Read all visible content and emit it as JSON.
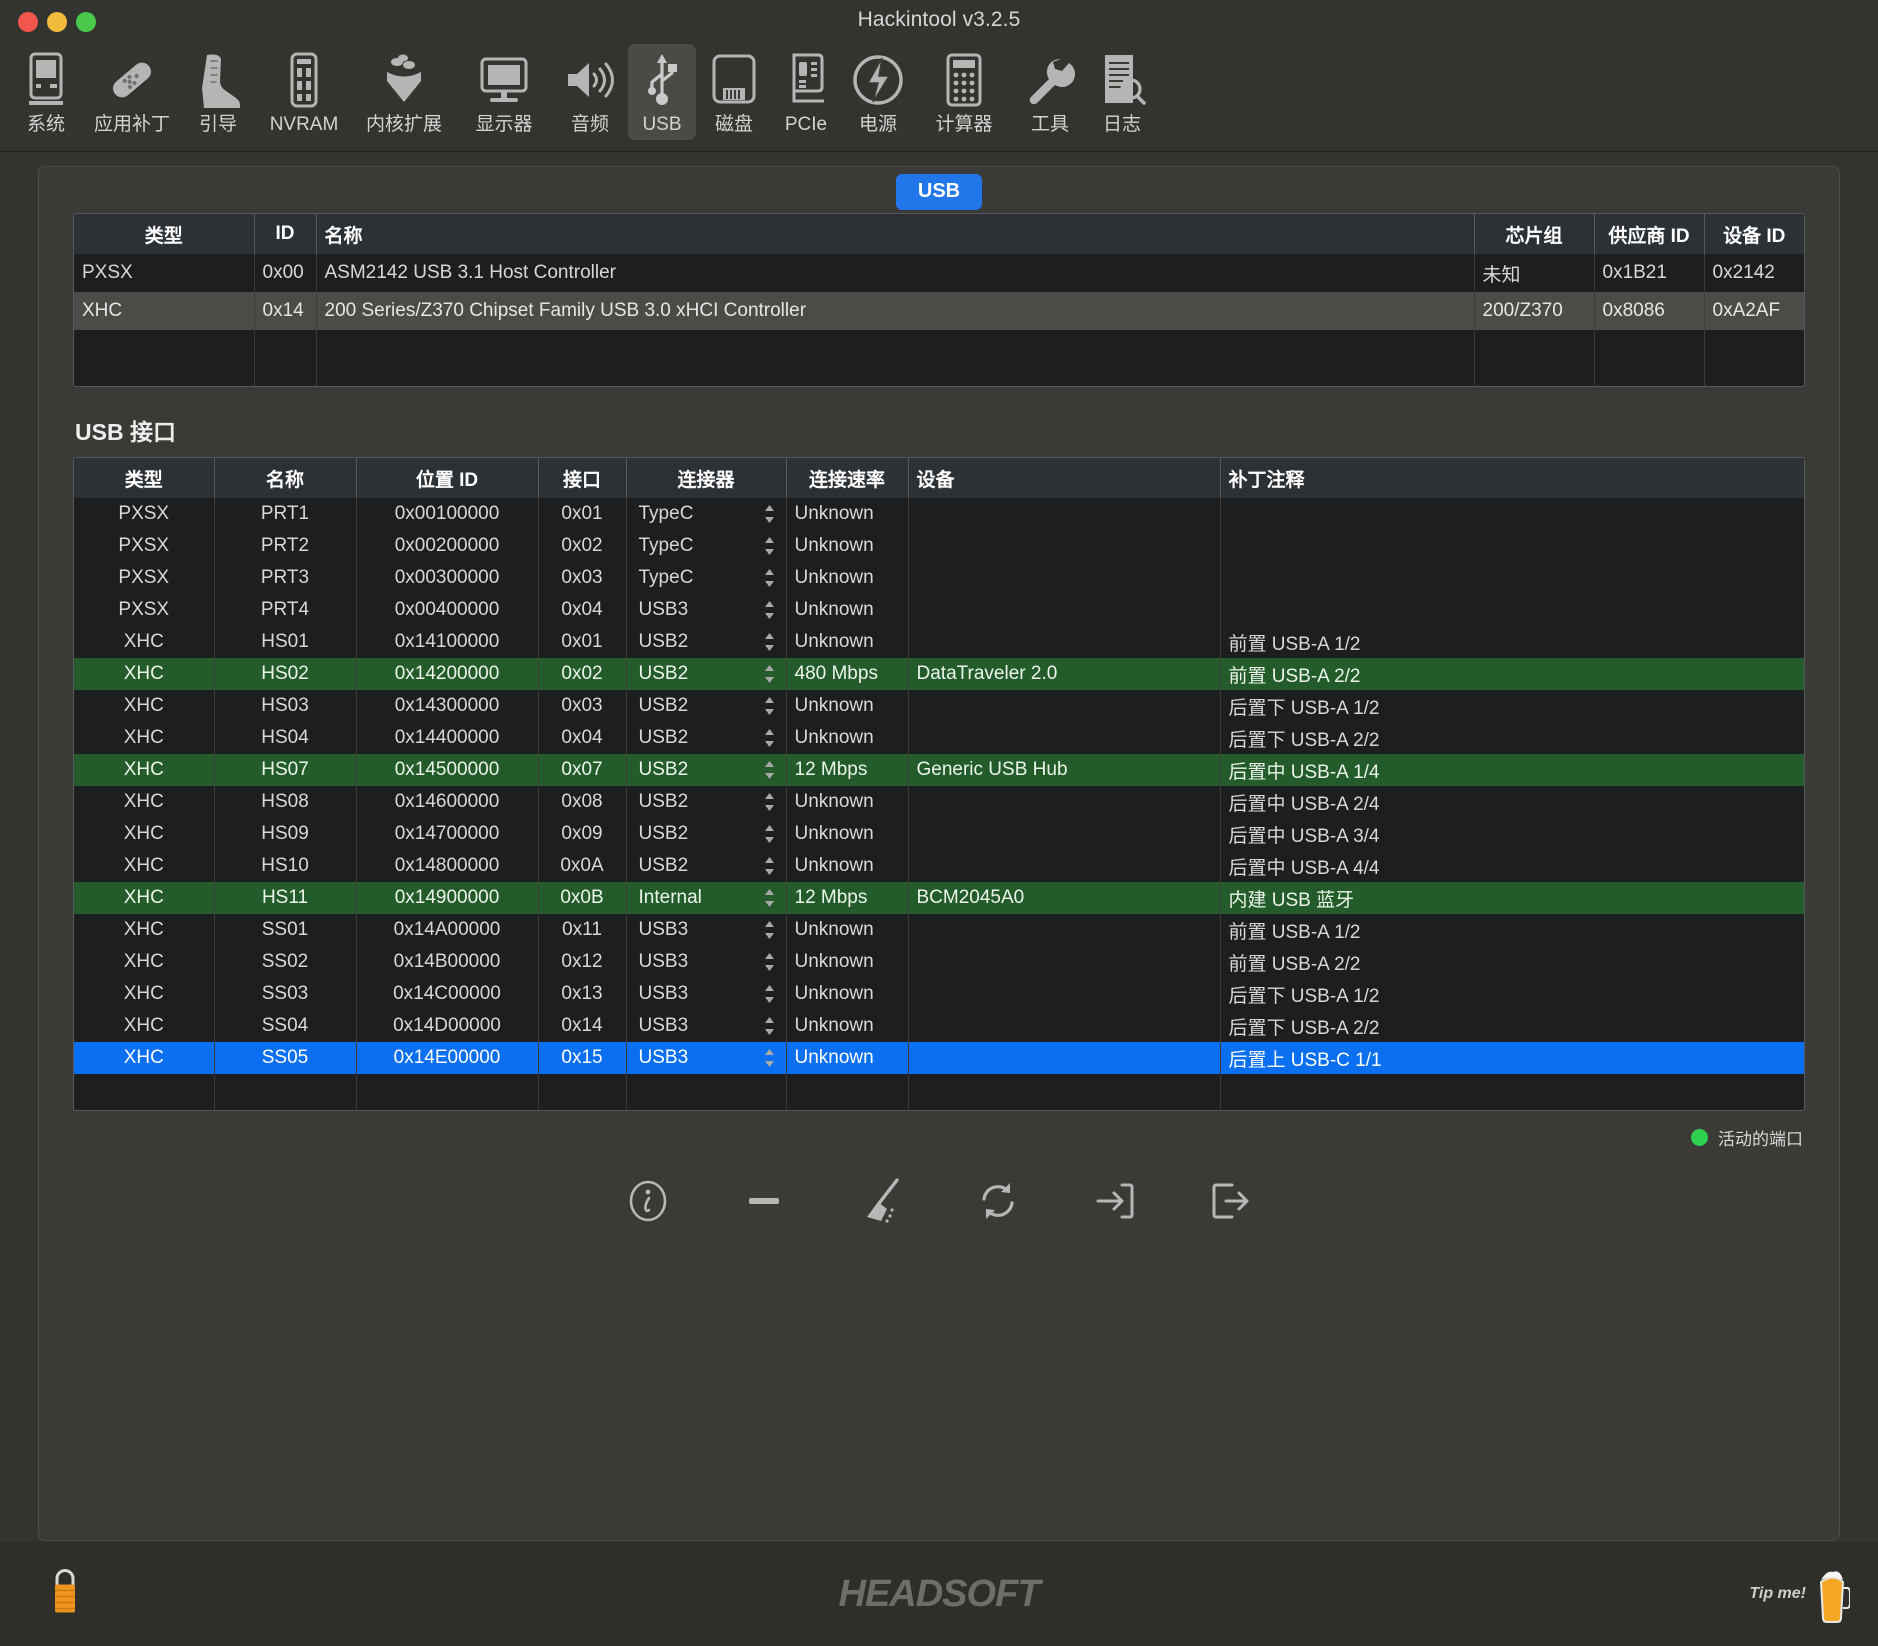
{
  "window": {
    "title": "Hackintool v3.2.5",
    "traffic_lights": [
      "close-button",
      "minimize-button",
      "zoom-button"
    ]
  },
  "toolbar": {
    "items": [
      {
        "label": "系统",
        "icon": "system-icon",
        "selected": false
      },
      {
        "label": "应用补丁",
        "icon": "patch-icon",
        "selected": false
      },
      {
        "label": "引导",
        "icon": "boot-icon",
        "selected": false
      },
      {
        "label": "NVRAM",
        "icon": "nvram-icon",
        "selected": false
      },
      {
        "label": "内核扩展",
        "icon": "kext-icon",
        "selected": false
      },
      {
        "label": "显示器",
        "icon": "display-icon",
        "selected": false
      },
      {
        "label": "音频",
        "icon": "audio-icon",
        "selected": false
      },
      {
        "label": "USB",
        "icon": "usb-icon",
        "selected": true
      },
      {
        "label": "磁盘",
        "icon": "disk-icon",
        "selected": false
      },
      {
        "label": "PCIe",
        "icon": "pcie-icon",
        "selected": false
      },
      {
        "label": "电源",
        "icon": "power-icon",
        "selected": false
      },
      {
        "label": "计算器",
        "icon": "calculator-icon",
        "selected": false
      },
      {
        "label": "工具",
        "icon": "tools-icon",
        "selected": false
      },
      {
        "label": "日志",
        "icon": "log-icon",
        "selected": false
      }
    ]
  },
  "tab": {
    "label": "USB"
  },
  "controllers": {
    "headers": [
      "类型",
      "ID",
      "名称",
      "芯片组",
      "供应商 ID",
      "设备 ID"
    ],
    "rows": [
      {
        "type": "PXSX",
        "id": "0x00",
        "name": "ASM2142 USB 3.1 Host Controller",
        "chipset": "未知",
        "vendor": "0x1B21",
        "device": "0x2142",
        "selected": false
      },
      {
        "type": "XHC",
        "id": "0x14",
        "name": "200 Series/Z370 Chipset Family USB 3.0 xHCI Controller",
        "chipset": "200/Z370",
        "vendor": "0x8086",
        "device": "0xA2AF",
        "selected": true
      }
    ]
  },
  "ports_section": {
    "title": "USB 接口"
  },
  "ports": {
    "headers": [
      "类型",
      "名称",
      "位置 ID",
      "接口",
      "连接器",
      "连接速率",
      "设备",
      "补丁注释"
    ],
    "rows": [
      {
        "type": "PXSX",
        "name": "PRT1",
        "location": "0x00100000",
        "port": "0x01",
        "connector": "TypeC",
        "speed": "Unknown",
        "device": "",
        "comment": "",
        "state": "normal"
      },
      {
        "type": "PXSX",
        "name": "PRT2",
        "location": "0x00200000",
        "port": "0x02",
        "connector": "TypeC",
        "speed": "Unknown",
        "device": "",
        "comment": "",
        "state": "normal"
      },
      {
        "type": "PXSX",
        "name": "PRT3",
        "location": "0x00300000",
        "port": "0x03",
        "connector": "TypeC",
        "speed": "Unknown",
        "device": "",
        "comment": "",
        "state": "normal"
      },
      {
        "type": "PXSX",
        "name": "PRT4",
        "location": "0x00400000",
        "port": "0x04",
        "connector": "USB3",
        "speed": "Unknown",
        "device": "",
        "comment": "",
        "state": "normal"
      },
      {
        "type": "XHC",
        "name": "HS01",
        "location": "0x14100000",
        "port": "0x01",
        "connector": "USB2",
        "speed": "Unknown",
        "device": "",
        "comment": "前置 USB-A 1/2",
        "state": "normal"
      },
      {
        "type": "XHC",
        "name": "HS02",
        "location": "0x14200000",
        "port": "0x02",
        "connector": "USB2",
        "speed": "480 Mbps",
        "device": "DataTraveler 2.0",
        "comment": "前置 USB-A 2/2",
        "state": "active"
      },
      {
        "type": "XHC",
        "name": "HS03",
        "location": "0x14300000",
        "port": "0x03",
        "connector": "USB2",
        "speed": "Unknown",
        "device": "",
        "comment": "后置下 USB-A 1/2",
        "state": "normal"
      },
      {
        "type": "XHC",
        "name": "HS04",
        "location": "0x14400000",
        "port": "0x04",
        "connector": "USB2",
        "speed": "Unknown",
        "device": "",
        "comment": "后置下 USB-A 2/2",
        "state": "normal"
      },
      {
        "type": "XHC",
        "name": "HS07",
        "location": "0x14500000",
        "port": "0x07",
        "connector": "USB2",
        "speed": "12 Mbps",
        "device": "Generic USB Hub",
        "comment": "后置中 USB-A 1/4",
        "state": "active"
      },
      {
        "type": "XHC",
        "name": "HS08",
        "location": "0x14600000",
        "port": "0x08",
        "connector": "USB2",
        "speed": "Unknown",
        "device": "",
        "comment": "后置中 USB-A 2/4",
        "state": "normal"
      },
      {
        "type": "XHC",
        "name": "HS09",
        "location": "0x14700000",
        "port": "0x09",
        "connector": "USB2",
        "speed": "Unknown",
        "device": "",
        "comment": "后置中 USB-A 3/4",
        "state": "normal"
      },
      {
        "type": "XHC",
        "name": "HS10",
        "location": "0x14800000",
        "port": "0x0A",
        "connector": "USB2",
        "speed": "Unknown",
        "device": "",
        "comment": "后置中 USB-A 4/4",
        "state": "normal"
      },
      {
        "type": "XHC",
        "name": "HS11",
        "location": "0x14900000",
        "port": "0x0B",
        "connector": "Internal",
        "speed": "12 Mbps",
        "device": "BCM2045A0",
        "comment": "内建 USB 蓝牙",
        "state": "active"
      },
      {
        "type": "XHC",
        "name": "SS01",
        "location": "0x14A00000",
        "port": "0x11",
        "connector": "USB3",
        "speed": "Unknown",
        "device": "",
        "comment": "前置 USB-A 1/2",
        "state": "normal"
      },
      {
        "type": "XHC",
        "name": "SS02",
        "location": "0x14B00000",
        "port": "0x12",
        "connector": "USB3",
        "speed": "Unknown",
        "device": "",
        "comment": "前置 USB-A 2/2",
        "state": "normal"
      },
      {
        "type": "XHC",
        "name": "SS03",
        "location": "0x14C00000",
        "port": "0x13",
        "connector": "USB3",
        "speed": "Unknown",
        "device": "",
        "comment": "后置下 USB-A 1/2",
        "state": "normal"
      },
      {
        "type": "XHC",
        "name": "SS04",
        "location": "0x14D00000",
        "port": "0x14",
        "connector": "USB3",
        "speed": "Unknown",
        "device": "",
        "comment": "后置下 USB-A 2/2",
        "state": "normal"
      },
      {
        "type": "XHC",
        "name": "SS05",
        "location": "0x14E00000",
        "port": "0x15",
        "connector": "USB3",
        "speed": "Unknown",
        "device": "",
        "comment": "后置上 USB-C 1/1",
        "state": "selected"
      }
    ]
  },
  "legend": {
    "label": "活动的端口",
    "color": "#2fd04f"
  },
  "actions": [
    {
      "name": "info-button",
      "icon": "info-circle-icon"
    },
    {
      "name": "remove-button",
      "icon": "minus-icon"
    },
    {
      "name": "clean-button",
      "icon": "broom-icon"
    },
    {
      "name": "refresh-button",
      "icon": "refresh-icon"
    },
    {
      "name": "import-button",
      "icon": "import-icon"
    },
    {
      "name": "export-button",
      "icon": "export-icon"
    }
  ],
  "footer": {
    "brand": "HEADSOFT",
    "tip_label": "Tip me!",
    "lock_icon": "lock-icon",
    "beer_icon": "beer-icon"
  },
  "colors": {
    "accent_blue": "#0a6ff0",
    "tab_blue": "#2176ea",
    "active_green": "#235b2b",
    "legend_green": "#2fd04f",
    "window_bg": "#333330",
    "panel_bg": "#3a3a37",
    "table_bg": "#1c1e20",
    "header_bg": "#2c3136"
  }
}
